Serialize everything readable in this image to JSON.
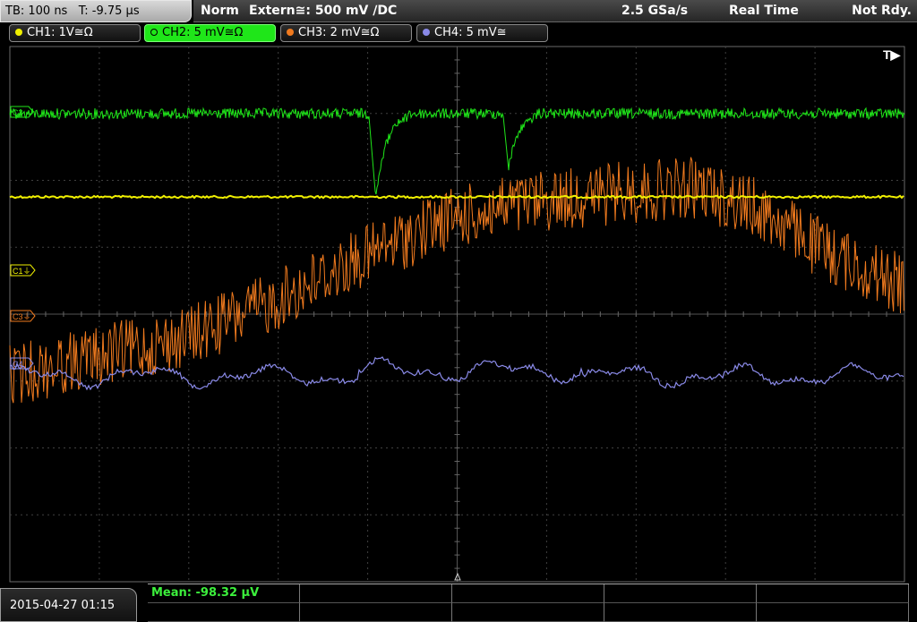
{
  "status_bar": {
    "timebase": "TB: 100 ns",
    "trigger_time": "T: -9.75 µs",
    "acq_mode": "Norm",
    "trigger_info": "Extern≅: 500 mV ∕DC",
    "sample_rate": "2.5 GSa/s",
    "acq_type": "Real Time",
    "ready_state": "Not Rdy."
  },
  "channels": [
    {
      "id": "ch1",
      "label": "CH1: 1V≅Ω",
      "color": "#f0f000"
    },
    {
      "id": "ch2",
      "label": "CH2: 5 mV≅Ω",
      "color": "#1fe619"
    },
    {
      "id": "ch3",
      "label": "CH3: 2 mV≅Ω",
      "color": "#f07a1e"
    },
    {
      "id": "ch4",
      "label": "CH4: 5 mV≅",
      "color": "#8a8ae8"
    }
  ],
  "markers": {
    "c1": "C1⏚",
    "c2": "C2",
    "c3": "C3⏚",
    "c4": "C4",
    "trigger": "T▶"
  },
  "measurement": {
    "mean": "Mean: -98.32 µV"
  },
  "datetime": "2015-04-27 01:15",
  "colors": {
    "grid": "#404040",
    "ch1": "#f0f000",
    "ch2": "#1fe619",
    "ch3": "#f07a1e",
    "ch4": "#8a8ae8"
  }
}
